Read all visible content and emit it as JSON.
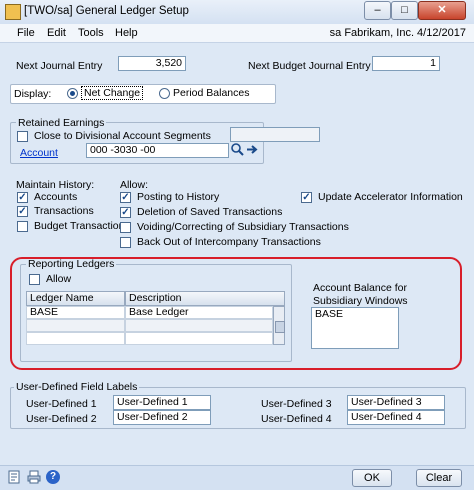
{
  "window": {
    "title": "[TWO/sa] General Ledger Setup",
    "minimize_glyph": "–",
    "maximize_glyph": "□",
    "close_glyph": "✕"
  },
  "menu": {
    "items": [
      "File",
      "Edit",
      "Tools",
      "Help"
    ],
    "context": "sa  Fabrikam, Inc.  4/12/2017"
  },
  "journal": {
    "next_entry_label": "Next Journal Entry",
    "next_entry_value": "3,520",
    "next_budget_label": "Next Budget Journal Entry",
    "next_budget_value": "1"
  },
  "display": {
    "label": "Display:",
    "options": [
      "Net Change",
      "Period Balances"
    ],
    "selected": "Net Change"
  },
  "retained_earnings": {
    "group_label": "Retained Earnings",
    "close_to_segments_label": "Close to Divisional Account Segments",
    "account_link": "Account",
    "account_value": "000 -3030 -00"
  },
  "maintain_history": {
    "label": "Maintain History:",
    "accounts": "Accounts",
    "transactions": "Transactions",
    "budget_transactions": "Budget Transactions"
  },
  "allow": {
    "label": "Allow:",
    "posting_to_history": "Posting to History",
    "deletion_saved": "Deletion of Saved Transactions",
    "voiding": "Voiding/Correcting of Subsidiary Transactions",
    "back_out": "Back Out of Intercompany Transactions",
    "update_accelerator": "Update Accelerator Information"
  },
  "reporting_ledgers": {
    "group_label": "Reporting Ledgers",
    "allow_label": "Allow",
    "col_ledger": "Ledger Name",
    "col_description": "Description",
    "rows": [
      {
        "ledger": "BASE",
        "description": "Base Ledger"
      },
      {
        "ledger": "",
        "description": ""
      },
      {
        "ledger": "",
        "description": ""
      }
    ],
    "balance_label_1": "Account Balance for",
    "balance_label_2": "Subsidiary Windows",
    "balance_value": "BASE"
  },
  "user_defined": {
    "group_label": "User-Defined Field Labels",
    "items": [
      {
        "label": "User-Defined 1",
        "value": "User-Defined 1"
      },
      {
        "label": "User-Defined 2",
        "value": "User-Defined 2"
      },
      {
        "label": "User-Defined 3",
        "value": "User-Defined 3"
      },
      {
        "label": "User-Defined 4",
        "value": "User-Defined 4"
      }
    ]
  },
  "footer": {
    "ok_label": "OK",
    "clear_label": "Clear",
    "help_glyph": "?"
  }
}
